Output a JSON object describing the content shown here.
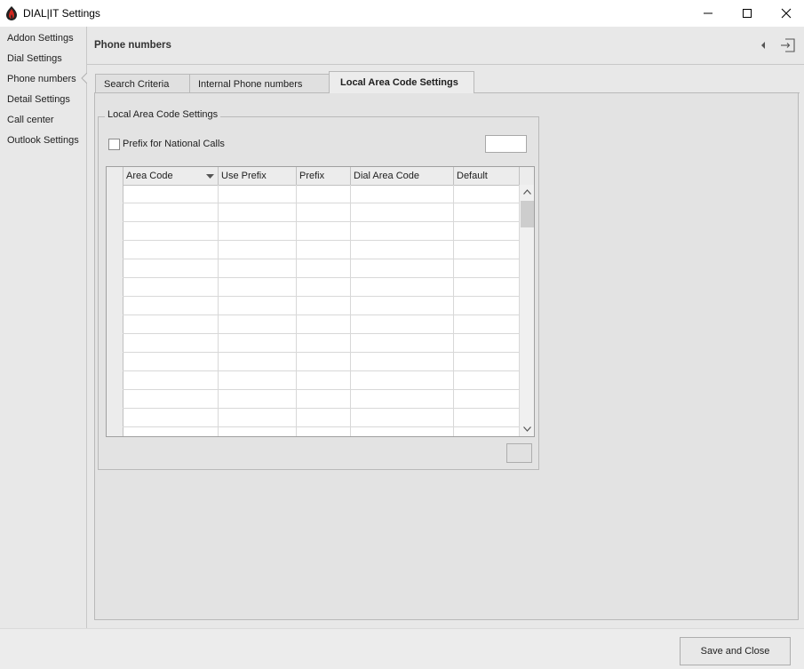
{
  "window": {
    "title": "DIAL|IT Settings",
    "app_icon": "dialit-flame-icon",
    "controls": [
      "minimize-icon",
      "maximize-icon",
      "close-icon"
    ]
  },
  "sidebar": {
    "items": [
      {
        "label": "Addon Settings"
      },
      {
        "label": "Dial Settings"
      },
      {
        "label": "Phone numbers",
        "selected": true
      },
      {
        "label": "Detail Settings"
      },
      {
        "label": "Call center"
      },
      {
        "label": "Outlook Settings"
      }
    ]
  },
  "header": {
    "title": "Phone numbers",
    "icons": [
      "collapse-left-icon",
      "exit-icon"
    ]
  },
  "tabs": [
    {
      "label": "Search Criteria"
    },
    {
      "label": "Internal Phone numbers"
    },
    {
      "label": "Local Area Code Settings",
      "active": true
    }
  ],
  "local_area": {
    "group_title": "Local Area Code Settings",
    "prefix_checkbox_label": "Prefix for National Calls",
    "prefix_checked": false,
    "prefix_value": "",
    "grid": {
      "columns": [
        "Area Code",
        "Use Prefix",
        "Prefix",
        "Dial Area Code",
        "Default"
      ],
      "sorted_column": "Area Code",
      "rows": []
    }
  },
  "footer": {
    "save_close_label": "Save and Close"
  },
  "colors": {
    "panel_bg": "#e8e8e8",
    "border": "#b9b9b9",
    "accent_red": "#c0392b"
  }
}
